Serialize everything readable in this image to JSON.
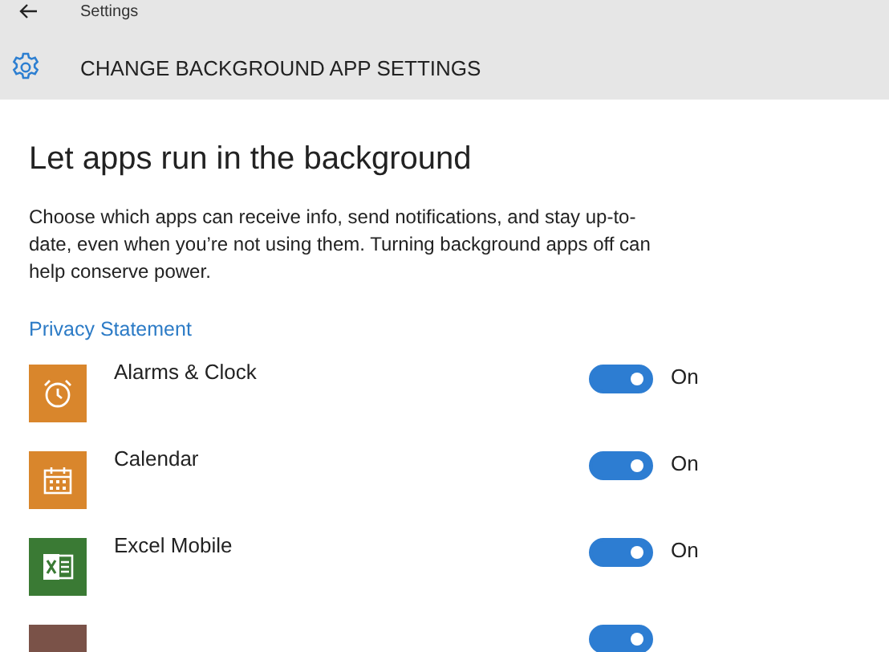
{
  "window": {
    "title": "Settings"
  },
  "page_header": {
    "title": "CHANGE BACKGROUND APP SETTINGS"
  },
  "heading": "Let apps run in the background",
  "description": "Choose which apps can receive info, send notifications, and stay up-to-date, even when you’re not using them. Turning background apps off can help conserve power.",
  "link": "Privacy Statement",
  "apps": [
    {
      "name": "Alarms & Clock",
      "kind": "alarm",
      "color": "#d9862c",
      "on": true,
      "state_label": "On"
    },
    {
      "name": "Calendar",
      "kind": "calendar",
      "color": "#d9862c",
      "on": true,
      "state_label": "On"
    },
    {
      "name": "Excel Mobile",
      "kind": "excel",
      "color": "#3a7a34",
      "on": true,
      "state_label": "On"
    },
    {
      "kind": "blank",
      "color": "#7a5248",
      "on": true
    }
  ]
}
